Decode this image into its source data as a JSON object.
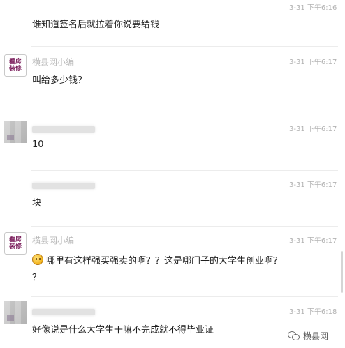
{
  "messages": [
    {
      "sender": "",
      "time": "3-31 下午6:16",
      "text": "谁知道签名后就拉着你说要给钱"
    },
    {
      "sender": "横县网小编",
      "time": "3-31 下午6:17",
      "text": "叫给多少钱？"
    },
    {
      "sender": "",
      "time": "3-31 下午6:17",
      "text": "10"
    },
    {
      "sender": "",
      "time": "3-31 下午6:17",
      "text": "块"
    },
    {
      "sender": "横县网小编",
      "time": "3-31 下午6:17",
      "text": "哪里有这样强买强卖的啊？？这是哪门子的大学生创业啊？",
      "text2": "？"
    },
    {
      "sender": "",
      "time": "3-31 下午6:18",
      "text": "好像说是什么大学生干嘛不完成就不得毕业证"
    }
  ],
  "avatar": {
    "line1": "看房",
    "line2": "装修"
  },
  "watermark": {
    "text": "横县网",
    "icon": "wechat-icon"
  },
  "colors": {
    "time": "#b3b3b3",
    "sender": "#b8b8b8",
    "text": "#1e1e1e",
    "avatar_logo": "#7b1f5c"
  }
}
